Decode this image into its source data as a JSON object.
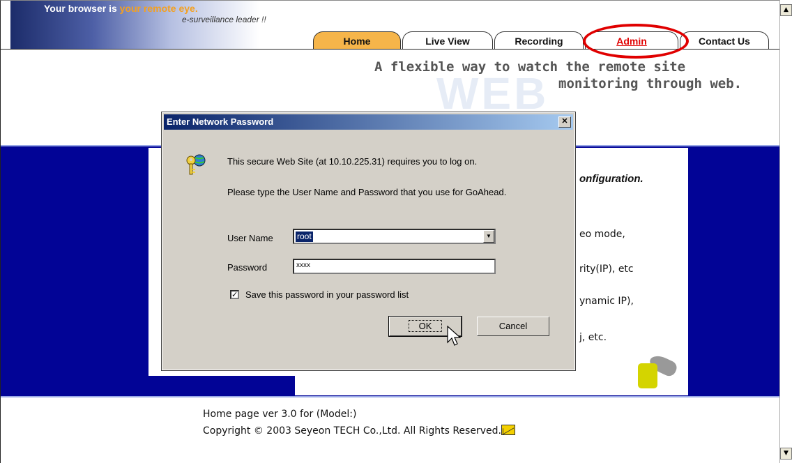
{
  "header": {
    "tagline_a": "Your browser is ",
    "tagline_b": "your remote eye.",
    "subtitle": "e-surveillance leader !!",
    "slogan_line1": "A flexible way to watch the remote site",
    "slogan_line2": "monitoring through web.",
    "watermark": "WEB"
  },
  "nav": {
    "tabs": [
      "Home",
      "Live View",
      "Recording",
      "Admin",
      "Contact Us"
    ],
    "active": "Home",
    "highlighted": "Admin"
  },
  "background_content": {
    "heading_fragment": "onfiguration.",
    "lines": [
      "eo mode,",
      "rity(IP), etc",
      "ynamic IP),",
      "j, etc."
    ]
  },
  "dialog": {
    "title": "Enter Network Password",
    "message1": "This secure Web Site (at 10.10.225.31) requires you to log on.",
    "message2": "Please type the User Name and Password that you use for GoAhead.",
    "username_label": "User Name",
    "username_value": "root",
    "password_label": "Password",
    "password_value": "xxxx",
    "save_label": "Save this password in your password list",
    "save_checked": true,
    "ok_label": "OK",
    "cancel_label": "Cancel"
  },
  "footer": {
    "version": "Home page ver 3.0 for (Model:)",
    "copyright": "Copyright © 2003 Seyeon TECH Co.,Ltd. All Rights Reserved."
  },
  "colors": {
    "band_blue": "#020496",
    "accent_orange": "#f4a020",
    "highlight_red": "#e00000",
    "dialog_title": "#0a246a"
  },
  "icons": [
    "key-globe-icon",
    "mail-icon",
    "close-icon",
    "dropdown-arrow-icon",
    "mouse-cursor-icon",
    "lock-key-icon",
    "scroll-up-icon",
    "scroll-down-icon"
  ]
}
